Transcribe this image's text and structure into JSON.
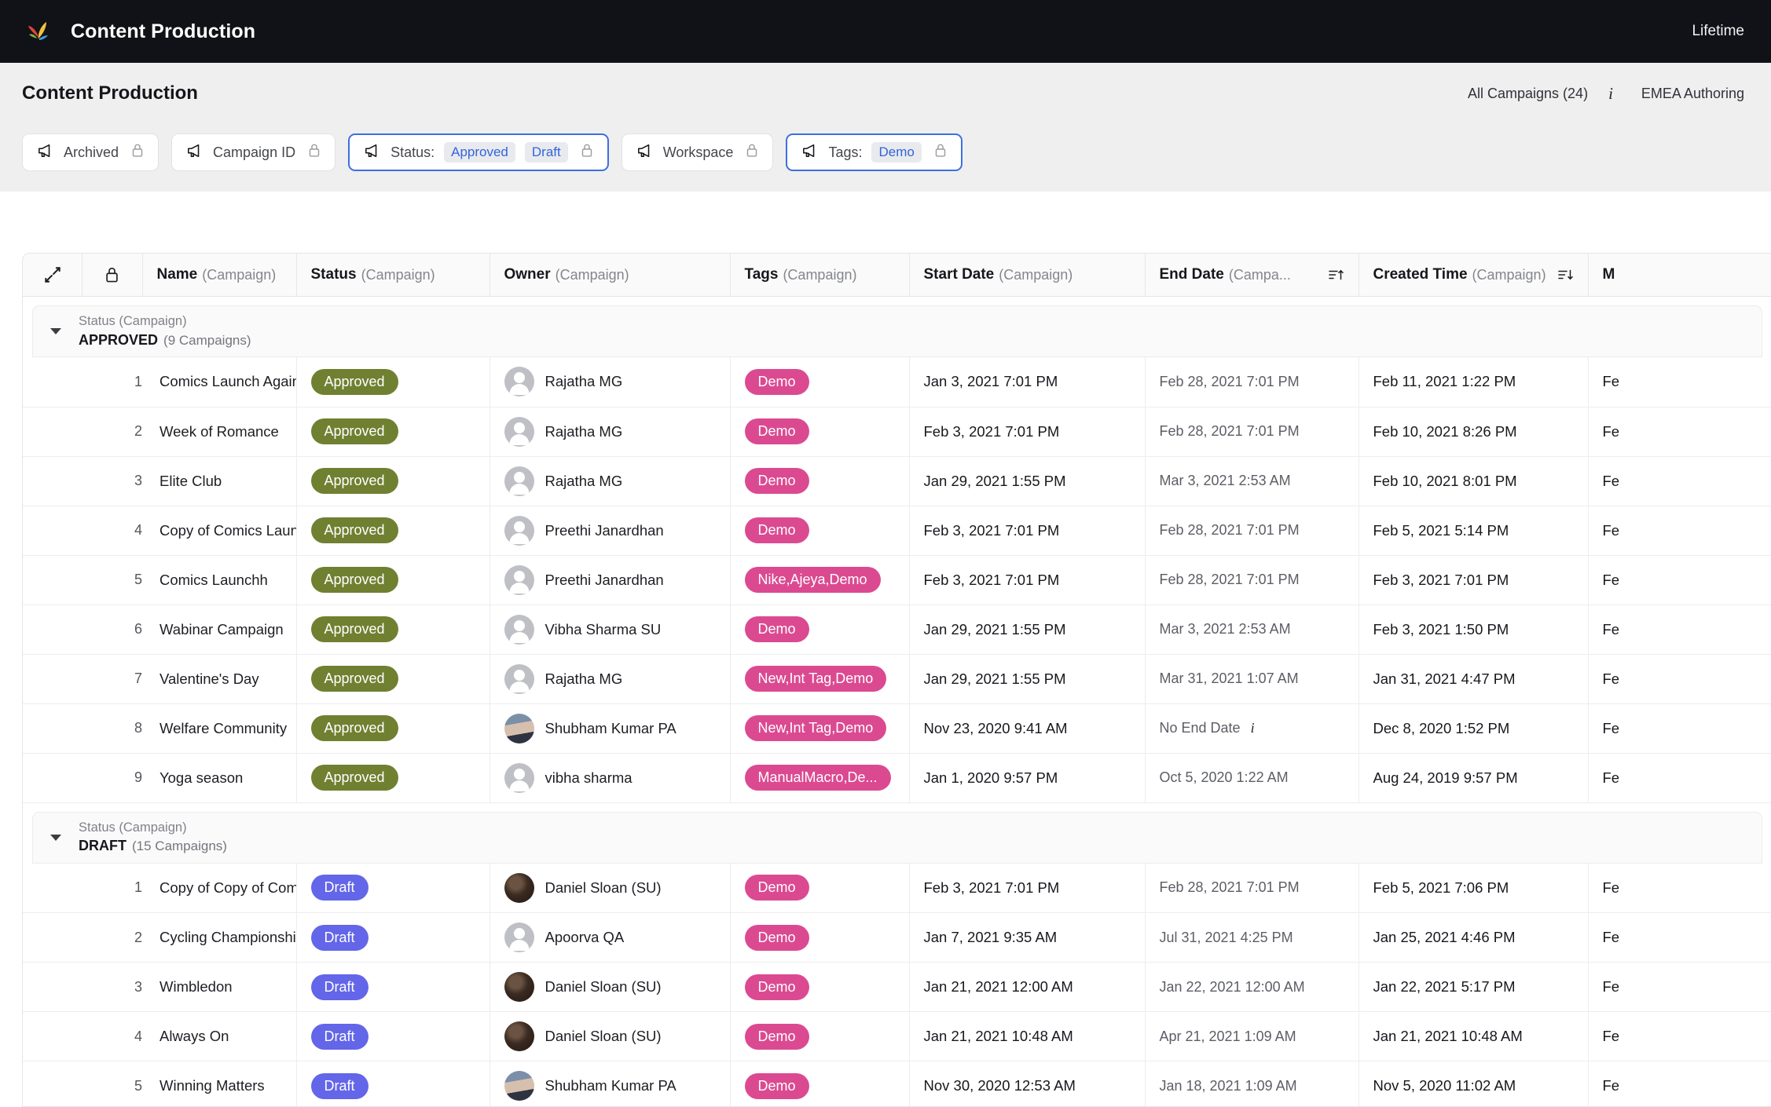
{
  "topbar": {
    "logo": "petal-logo",
    "app_title": "Content Production",
    "right_label": "Lifetime"
  },
  "page_header": {
    "title": "Content Production",
    "all_campaigns": "All Campaigns (24)",
    "info_icon": "info-icon",
    "workspace": "EMEA Authoring"
  },
  "filters": [
    {
      "icon": "megaphone-icon",
      "label": "Archived",
      "values": [],
      "active": false,
      "lock": "lock-icon"
    },
    {
      "icon": "megaphone-icon",
      "label": "Campaign ID",
      "values": [],
      "active": false,
      "lock": "lock-icon"
    },
    {
      "icon": "megaphone-icon",
      "label": "Status:",
      "values": [
        "Approved",
        "Draft"
      ],
      "active": true,
      "lock": "lock-icon"
    },
    {
      "icon": "megaphone-icon",
      "label": "Workspace",
      "values": [],
      "active": false,
      "lock": "lock-icon"
    },
    {
      "icon": "megaphone-icon",
      "label": "Tags:",
      "values": [
        "Demo"
      ],
      "active": true,
      "lock": "lock-icon"
    }
  ],
  "table": {
    "util_icons": [
      "collapse-arrows-icon",
      "lock-icon"
    ],
    "columns": [
      {
        "main": "Name",
        "sub": "(Campaign)",
        "sort": ""
      },
      {
        "main": "Status",
        "sub": "(Campaign)",
        "sort": ""
      },
      {
        "main": "Owner",
        "sub": "(Campaign)",
        "sort": ""
      },
      {
        "main": "Tags",
        "sub": "(Campaign)",
        "sort": ""
      },
      {
        "main": "Start Date",
        "sub": "(Campaign)",
        "sort": ""
      },
      {
        "main": "End Date",
        "sub": "(Campa...",
        "sort": "sort-asc-icon"
      },
      {
        "main": "Created Time",
        "sub": "(Campaign)",
        "sort": "sort-desc-icon"
      },
      {
        "main": "M",
        "sub": "",
        "sort": ""
      }
    ],
    "colors": {
      "approved": "#6f8031",
      "draft": "#6366e8",
      "tag": "#db4a91",
      "accent": "#3d6fe0"
    },
    "groups": [
      {
        "sub": "Status (Campaign)",
        "name": "APPROVED",
        "count": "(9 Campaigns)",
        "rows": [
          {
            "idx": "1",
            "name": "Comics Launch Again New",
            "status": "Approved",
            "owner": "Rajatha MG",
            "avatar": "placeholder",
            "tags": "Demo",
            "start": "Jan 3, 2021 7:01 PM",
            "end": "Feb 28, 2021 7:01 PM",
            "created": "Feb 11, 2021 1:22 PM",
            "modified": "Fe"
          },
          {
            "idx": "2",
            "name": "Week of Romance",
            "status": "Approved",
            "owner": "Rajatha MG",
            "avatar": "placeholder",
            "tags": "Demo",
            "start": "Feb 3, 2021 7:01 PM",
            "end": "Feb 28, 2021 7:01 PM",
            "created": "Feb 10, 2021 8:26 PM",
            "modified": "Fe"
          },
          {
            "idx": "3",
            "name": "Elite Club",
            "status": "Approved",
            "owner": "Rajatha MG",
            "avatar": "placeholder",
            "tags": "Demo",
            "start": "Jan 29, 2021 1:55 PM",
            "end": "Mar 3, 2021 2:53 AM",
            "created": "Feb 10, 2021 8:01 PM",
            "modified": "Fe"
          },
          {
            "idx": "4",
            "name": "Copy of Comics Launch",
            "status": "Approved",
            "owner": "Preethi Janardhan",
            "avatar": "placeholder",
            "tags": "Demo",
            "start": "Feb 3, 2021 7:01 PM",
            "end": "Feb 28, 2021 7:01 PM",
            "created": "Feb 5, 2021 5:14 PM",
            "modified": "Fe"
          },
          {
            "idx": "5",
            "name": "Comics Launchh",
            "status": "Approved",
            "owner": "Preethi Janardhan",
            "avatar": "placeholder",
            "tags": "Nike,Ajeya,Demo",
            "start": "Feb 3, 2021 7:01 PM",
            "end": "Feb 28, 2021 7:01 PM",
            "created": "Feb 3, 2021 7:01 PM",
            "modified": "Fe"
          },
          {
            "idx": "6",
            "name": "Wabinar Campaign",
            "status": "Approved",
            "owner": "Vibha Sharma SU",
            "avatar": "placeholder",
            "tags": "Demo",
            "start": "Jan 29, 2021 1:55 PM",
            "end": "Mar 3, 2021 2:53 AM",
            "created": "Feb 3, 2021 1:50 PM",
            "modified": "Fe"
          },
          {
            "idx": "7",
            "name": "Valentine's Day",
            "status": "Approved",
            "owner": "Rajatha MG",
            "avatar": "placeholder",
            "tags": "New,Int Tag,Demo",
            "start": "Jan 29, 2021 1:55 PM",
            "end": "Mar 31, 2021 1:07 AM",
            "created": "Jan 31, 2021 4:47 PM",
            "modified": "Fe"
          },
          {
            "idx": "8",
            "name": "Welfare Community",
            "status": "Approved",
            "owner": "Shubham Kumar PA",
            "avatar": "shubham-photo",
            "tags": "New,Int Tag,Demo",
            "start": "Nov 23, 2020 9:41 AM",
            "end": "No End Date",
            "created": "Dec 8, 2020 1:52 PM",
            "modified": "Fe"
          },
          {
            "idx": "9",
            "name": "Yoga season",
            "status": "Approved",
            "owner": "vibha sharma",
            "avatar": "placeholder",
            "tags": "ManualMacro,De...",
            "start": "Jan 1, 2020 9:57 PM",
            "end": "Oct 5, 2020 1:22 AM",
            "created": "Aug 24, 2019 9:57 PM",
            "modified": "Fe"
          }
        ]
      },
      {
        "sub": "Status (Campaign)",
        "name": "DRAFT",
        "count": "(15 Campaigns)",
        "rows": [
          {
            "idx": "1",
            "name": "Copy of Copy of Comics Launch",
            "status": "Draft",
            "owner": "Daniel Sloan (SU)",
            "avatar": "daniel-photo",
            "tags": "Demo",
            "start": "Feb 3, 2021 7:01 PM",
            "end": "Feb 28, 2021 7:01 PM",
            "created": "Feb 5, 2021 7:06 PM",
            "modified": "Fe"
          },
          {
            "idx": "2",
            "name": "Cycling Championship",
            "status": "Draft",
            "owner": "Apoorva QA",
            "avatar": "placeholder",
            "tags": "Demo",
            "start": "Jan 7, 2021 9:35 AM",
            "end": "Jul 31, 2021 4:25 PM",
            "created": "Jan 25, 2021 4:46 PM",
            "modified": "Fe"
          },
          {
            "idx": "3",
            "name": "Wimbledon",
            "status": "Draft",
            "owner": "Daniel Sloan (SU)",
            "avatar": "daniel-photo",
            "tags": "Demo",
            "start": "Jan 21, 2021 12:00 AM",
            "end": "Jan 22, 2021 12:00 AM",
            "created": "Jan 22, 2021 5:17 PM",
            "modified": "Fe"
          },
          {
            "idx": "4",
            "name": "Always On",
            "status": "Draft",
            "owner": "Daniel Sloan (SU)",
            "avatar": "daniel-photo",
            "tags": "Demo",
            "start": "Jan 21, 2021 10:48 AM",
            "end": "Apr 21, 2021 1:09 AM",
            "created": "Jan 21, 2021 10:48 AM",
            "modified": "Fe"
          },
          {
            "idx": "5",
            "name": "Winning Matters",
            "status": "Draft",
            "owner": "Shubham Kumar PA",
            "avatar": "shubham-photo",
            "tags": "Demo",
            "start": "Nov 30, 2020 12:53 AM",
            "end": "Jan 18, 2021 1:09 AM",
            "created": "Nov 5, 2020 11:02 AM",
            "modified": "Fe"
          }
        ]
      }
    ],
    "no_end_info_icon": "info-icon"
  }
}
